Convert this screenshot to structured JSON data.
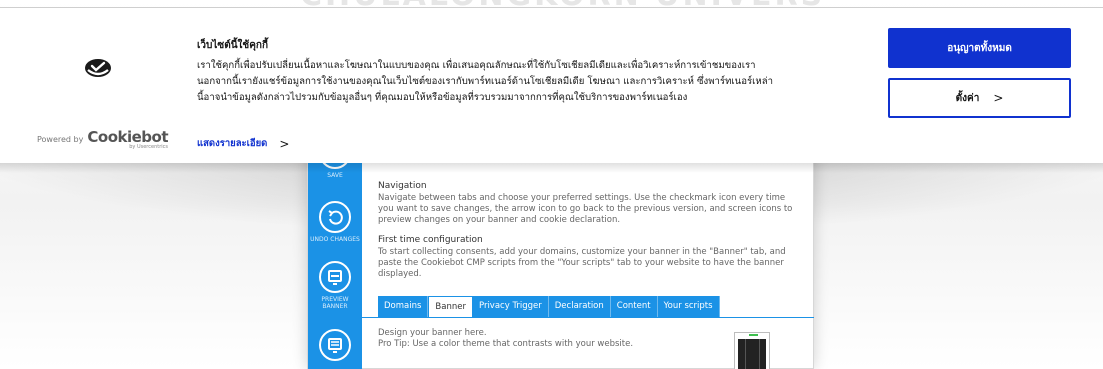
{
  "background": {
    "watermark": "CHULALONGKORN UNIVERSITY",
    "sidebar": {
      "save_label": "SAVE",
      "undo_label": "UNDO CHANGES",
      "preview_label": "PREVIEW BANNER"
    },
    "navigation": {
      "title": "Navigation",
      "text": "Navigate between tabs and choose your preferred settings. Use the checkmark icon every time you want to save changes, the arrow icon to go back to the previous version, and screen icons to preview changes on your banner and cookie declaration."
    },
    "first_time": {
      "title": "First time configuration",
      "text": "To start collecting consents, add your domains, customize your banner in the \"Banner\" tab, and paste the Cookiebot CMP scripts from the \"Your scripts\" tab to your website to have the banner displayed."
    },
    "tabs": [
      "Domains",
      "Banner",
      "Privacy Trigger",
      "Declaration",
      "Content",
      "Your scripts"
    ],
    "active_tab": "Banner",
    "design_line1": "Design your banner here.",
    "design_line2": "Pro Tip: Use a color theme that contrasts with your website."
  },
  "banner": {
    "title": "เว็บไซต์นี้ใช้คุกกี้",
    "text_lines": [
      "เราใช้คุกกี้เพื่อปรับเปลี่ยนเนื้อหาและโฆษณาในแบบของคุณ เพื่อเสนอคุณลักษณะที่ใช้กับโซเชียลมีเดียและเพื่อวิเคราะห์การเข้าชมของเรา",
      "นอกจากนี้เรายังแชร์ข้อมูลการใช้งานของคุณในเว็บไซต์ของเรากับพาร์ทเนอร์ด้านโซเชียลมีเดีย โฆษณา และการวิเคราะห์ ซึ่งพาร์ทเนอร์เหล่า",
      "นี้อาจนำข้อมูลดังกล่าวไปรวมกับข้อมูลอื่นๆ ที่คุณมอบให้หรือข้อมูลที่รวบรวมมาจากการที่คุณใช้บริการของพาร์ทเนอร์เอง"
    ],
    "details_link": "แสดงรายละเอียด",
    "powered_by": "Powered by",
    "brand": "Cookiebot",
    "brand_sub": "by Usercentrics",
    "accept_all": "อนุญาตทั้งหมด",
    "settings": "ตั้งค่า",
    "accent_color": "#1032cf"
  }
}
